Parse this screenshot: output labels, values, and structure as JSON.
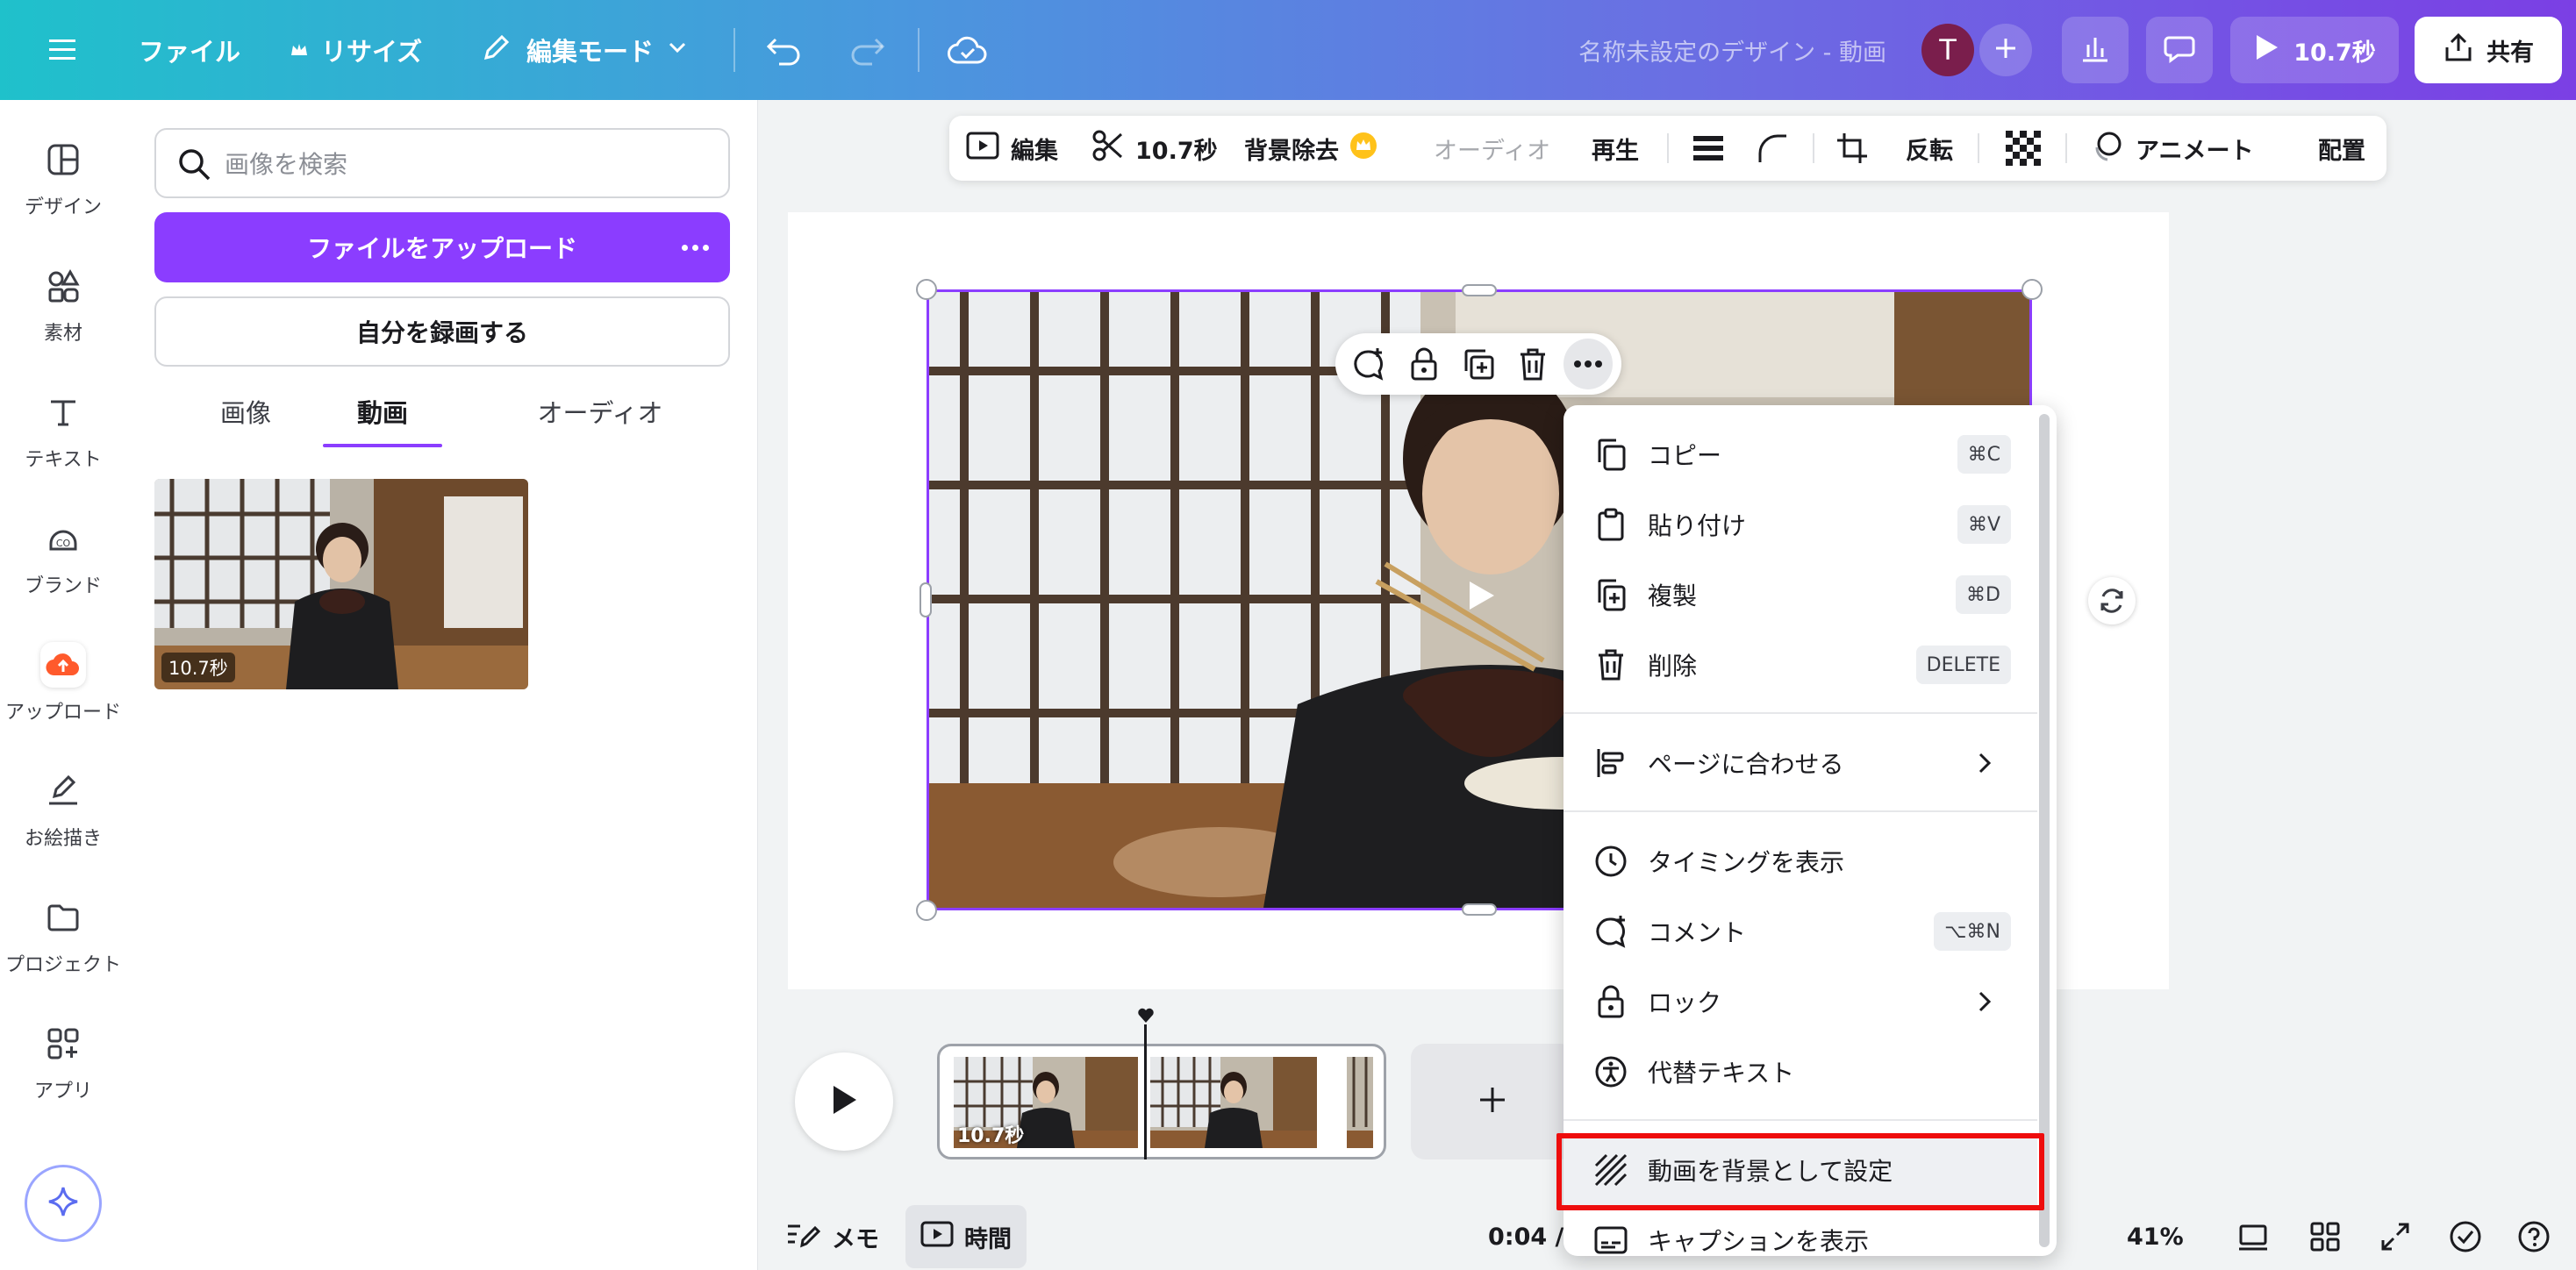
{
  "topbar": {
    "file": "ファイル",
    "resize": "リサイズ",
    "edit_mode": "編集モード",
    "doc_title": "名称未設定のデザイン - 動画",
    "avatar_initial": "T",
    "play_duration": "10.7秒",
    "share": "共有"
  },
  "rail": {
    "design": "デザイン",
    "elements": "素材",
    "text": "テキスト",
    "brand": "ブランド",
    "upload": "アップロード",
    "draw": "お絵描き",
    "projects": "プロジェクト",
    "apps": "アプリ"
  },
  "panel": {
    "search_placeholder": "画像を検索",
    "upload_button": "ファイルをアップロード",
    "record_button": "自分を録画する",
    "tabs": [
      "画像",
      "動画",
      "オーディオ"
    ],
    "video_duration": "10.7秒"
  },
  "context_toolbar": {
    "edit": "編集",
    "duration": "10.7秒",
    "bg_remove": "背景除去",
    "audio": "オーディオ",
    "playback": "再生",
    "flip": "反転",
    "animate": "アニメート",
    "position": "配置"
  },
  "menu": {
    "items": [
      {
        "label": "コピー",
        "shortcut": "⌘C"
      },
      {
        "label": "貼り付け",
        "shortcut": "⌘V"
      },
      {
        "label": "複製",
        "shortcut": "⌘D"
      },
      {
        "label": "削除",
        "shortcut": "DELETE"
      },
      {
        "label": "ページに合わせる"
      },
      {
        "label": "タイミングを表示"
      },
      {
        "label": "コメント",
        "shortcut": "⌥⌘N"
      },
      {
        "label": "ロック"
      },
      {
        "label": "代替テキスト"
      },
      {
        "label": "動画を背景として設定"
      },
      {
        "label": "キャプションを表示"
      }
    ]
  },
  "timeline": {
    "clip_duration": "10.7秒"
  },
  "bottombar": {
    "notes": "メモ",
    "timer": "時間",
    "time": "0:04 /",
    "zoom": "41%"
  },
  "colors": {
    "accent": "#8b3dff",
    "highlight": "#ee0d0d"
  }
}
